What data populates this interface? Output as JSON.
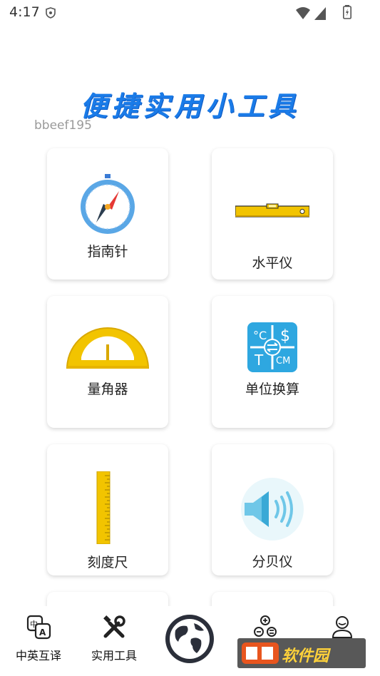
{
  "status_bar": {
    "time": "4:17"
  },
  "header": {
    "title": "便捷实用小工具",
    "username": "bbeef195"
  },
  "tools": [
    {
      "label": "指南针",
      "icon": "compass-icon"
    },
    {
      "label": "水平仪",
      "icon": "spirit-level-icon"
    },
    {
      "label": "量角器",
      "icon": "protractor-icon"
    },
    {
      "label": "单位换算",
      "icon": "unit-converter-icon"
    },
    {
      "label": "刻度尺",
      "icon": "ruler-icon"
    },
    {
      "label": "分贝仪",
      "icon": "speaker-icon"
    }
  ],
  "bottom_nav": {
    "items": [
      {
        "label": "中英互译",
        "icon": "translate-icon"
      },
      {
        "label": "实用工具",
        "icon": "tools-icon"
      },
      {
        "label": "",
        "icon": "globe-icon"
      },
      {
        "label": "",
        "icon": "formula-icon"
      },
      {
        "label": "",
        "icon": "user-icon"
      }
    ]
  },
  "colors": {
    "title_blue": "#1a7be8",
    "level_yellow": "#f2c400",
    "converter_blue": "#2ea7e0"
  }
}
